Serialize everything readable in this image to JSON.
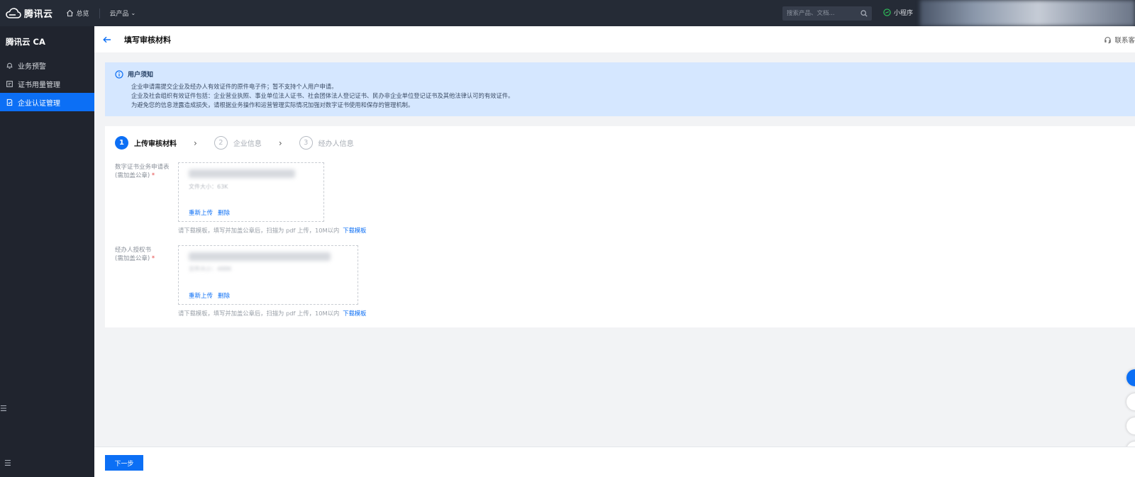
{
  "topbar": {
    "brand": "腾讯云",
    "overview": "总览",
    "products": "云产品",
    "search_placeholder": "搜索产品、文档...",
    "miniapp": "小程序"
  },
  "sidebar": {
    "title": "腾讯云 CA",
    "items": [
      {
        "label": "业务预警",
        "icon": "bell-icon"
      },
      {
        "label": "证书用量管理",
        "icon": "certificate-icon"
      },
      {
        "label": "企业认证管理",
        "icon": "document-check-icon"
      }
    ],
    "active_index": 2
  },
  "header": {
    "title": "填写审核材料",
    "contact": "联系客"
  },
  "notice": {
    "title": "用户须知",
    "lines": [
      "企业申请需提交企业及经办人有效证件的原件电子件；暂不支持个人用户申请。",
      "企业及社会组织有效证件包括：企业营业执照、事业单位法人证书、社会团体法人登记证书、民办非企业单位登记证书及其他法律认可的有效证件。",
      "为避免您的信息泄露造成损失，请根据业务操作和运营管理实际情况加强对数字证书使用和保存的管理机制。"
    ]
  },
  "steps": [
    {
      "num": "1",
      "label": "上传审核材料",
      "active": true
    },
    {
      "num": "2",
      "label": "企业信息",
      "active": false
    },
    {
      "num": "3",
      "label": "经办人信息",
      "active": false
    }
  ],
  "fields": [
    {
      "label_line1": "数字证书业务申请表",
      "label_line2": "(需加盖公章)",
      "required": "*",
      "file_size": "文件大小：63K",
      "reupload": "重新上传",
      "delete": "删除",
      "hint": "请下载模板，填写并加盖公章后，扫描为 pdf 上传，10M以内",
      "download": "下载模板"
    },
    {
      "label_line1": "经办人授权书",
      "label_line2": "(需加盖公章)",
      "required": "*",
      "file_size": "文件大小：488K",
      "reupload": "重新上传",
      "delete": "删除",
      "hint": "请下载模板，填写并加盖公章后，扫描为 pdf 上传，10M以内",
      "download": "下载模板"
    }
  ],
  "footer": {
    "next": "下一步"
  },
  "colors": {
    "primary": "#0c6ff5",
    "topbar": "#252b36",
    "sidebar": "#20242e",
    "notice_bg": "#d5e7ff"
  }
}
